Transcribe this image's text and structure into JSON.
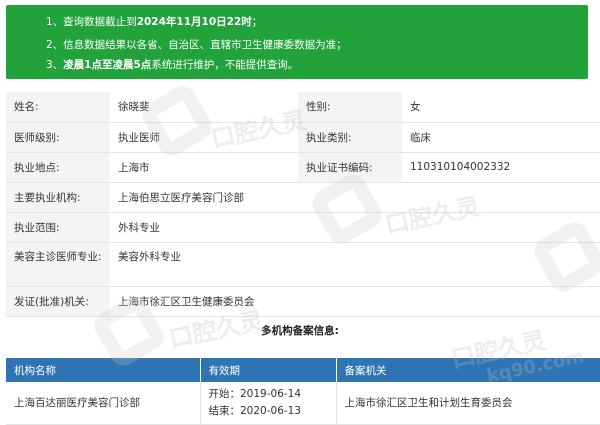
{
  "notice": {
    "line1_a": "1、查询数据截止到",
    "line1_b": "2024年11月10日22时",
    "line1_c": "；",
    "line2": "2、信息数据结果以各省、自治区、直辖市卫生健康委数据为准；",
    "line3_a": "3、",
    "line3_b": "凌晨1点至凌晨5点",
    "line3_c": "系统进行维护，不能提供查询。"
  },
  "info": {
    "name_label": "姓名:",
    "name_value": "徐晓斐",
    "gender_label": "性别:",
    "gender_value": "女",
    "level_label": "医师级别:",
    "level_value": "执业医师",
    "category_label": "执业类别:",
    "category_value": "临床",
    "place_label": "执业地点:",
    "place_value": "上海市",
    "cert_label": "执业证书编码:",
    "cert_value": "110310104002332",
    "org_label": "主要执业机构:",
    "org_value": "上海伯思立医疗美容门诊部",
    "scope_label": "执业范围:",
    "scope_value": "外科专业",
    "cosmetic_label": "美容主诊医师专业:",
    "cosmetic_value": "美容外科专业",
    "issuer_label": "发证(批准)机关:",
    "issuer_value": "上海市徐汇区卫生健康委员会"
  },
  "multi": {
    "title": "多机构备案信息:",
    "headers": [
      "机构名称",
      "有效期",
      "备案机关"
    ],
    "rows": [
      {
        "org": "上海百达丽医疗美容门诊部",
        "start": "开始：2019-06-14",
        "end": "结束：2020-06-13",
        "authority": "上海市徐汇区卫生和计划生育委员会"
      }
    ]
  },
  "watermark": {
    "text": "口腔久灵",
    "domain": "kq90.com"
  },
  "colors": {
    "notice_bg": "#22a23b",
    "table_header_bg": "#2f75b5",
    "label_bg": "#f4f4f4"
  }
}
